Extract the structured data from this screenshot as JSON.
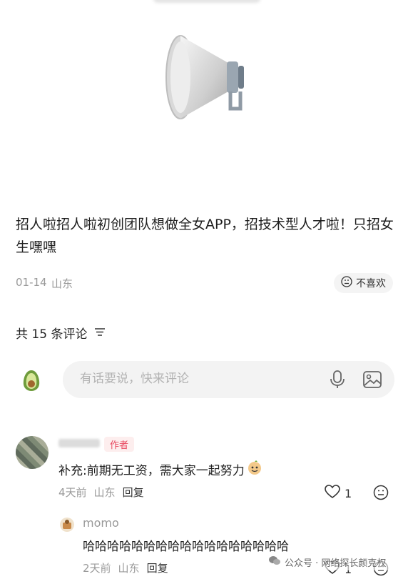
{
  "post": {
    "text": "招人啦招人啦初创团队想做全女APP，招技术型人才啦！只招女生嘿嘿",
    "date": "01-14",
    "location": "山东",
    "dislike_label": "不喜欢"
  },
  "comments_header": {
    "title": "共 15 条评论"
  },
  "comment_input": {
    "placeholder": "有话要说，快来评论"
  },
  "comments": [
    {
      "author_tag": "作者",
      "text": "补充:前期无工资，需大家一起努力",
      "time": "4天前",
      "location": "山东",
      "reply_label": "回复",
      "likes": "1",
      "replies": [
        {
          "author": "momo",
          "text": "哈哈哈哈哈哈哈哈哈哈哈哈哈哈哈哈哈",
          "time": "2天前",
          "location": "山东",
          "reply_label": "回复",
          "likes": "1"
        }
      ]
    }
  ],
  "watermark": {
    "text": "公众号 · 网络探长颜克权"
  },
  "icons": [
    "megaphone-icon",
    "dislike-face-icon",
    "sort-icon",
    "avocado-icon",
    "microphone-icon",
    "image-icon",
    "heart-icon",
    "emoji-icon",
    "wechat-icon"
  ]
}
